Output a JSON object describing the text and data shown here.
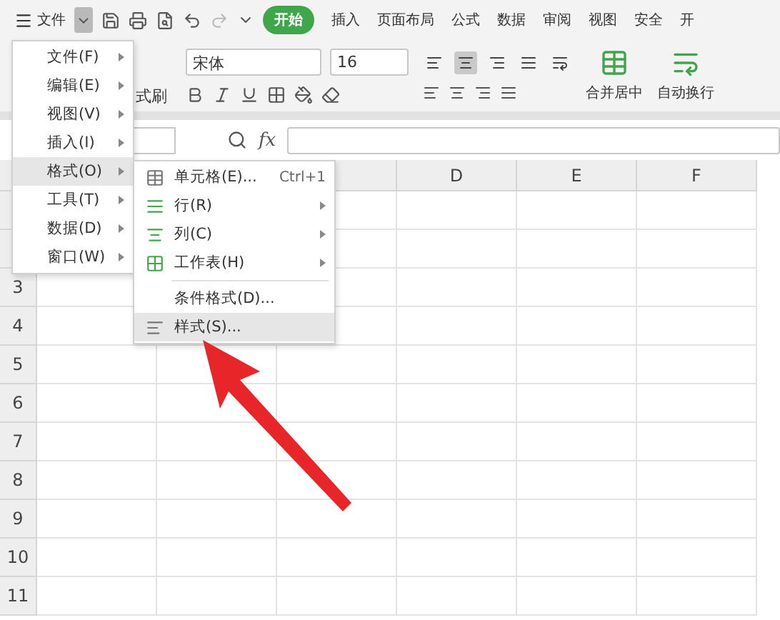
{
  "menu_bar": {
    "file_button": "文件",
    "start_tab": "开始",
    "tabs": [
      "插入",
      "页面布局",
      "公式",
      "数据",
      "审阅",
      "视图",
      "安全",
      "开"
    ]
  },
  "ribbon": {
    "format_painter": "式刷",
    "font_name": "宋体",
    "font_size": "16",
    "merge_button": "合并居中",
    "wrap_button": "自动换行",
    "align_buttons": [
      {
        "selected": false
      },
      {
        "selected": true
      },
      {
        "selected": false
      },
      {
        "selected": false
      },
      {
        "selected": false
      }
    ]
  },
  "formula_bar": {
    "fx": "fx"
  },
  "sheet": {
    "column_headers": [
      "D",
      "E",
      "F"
    ],
    "row_headers": [
      "3",
      "4",
      "5",
      "6",
      "7",
      "8",
      "9",
      "10",
      "11"
    ]
  },
  "main_menu": [
    {
      "label": "文件(F)",
      "selected": false,
      "has_submenu": true
    },
    {
      "label": "编辑(E)",
      "selected": false,
      "has_submenu": true
    },
    {
      "label": "视图(V)",
      "selected": false,
      "has_submenu": true
    },
    {
      "label": "插入(I)",
      "selected": false,
      "has_submenu": true
    },
    {
      "label": "格式(O)",
      "selected": true,
      "has_submenu": true
    },
    {
      "label": "工具(T)",
      "selected": false,
      "has_submenu": true
    },
    {
      "label": "数据(D)",
      "selected": false,
      "has_submenu": true
    },
    {
      "label": "窗口(W)",
      "selected": false,
      "has_submenu": true
    }
  ],
  "submenu": [
    {
      "kind": "item",
      "label": "单元格(E)...",
      "shortcut": "Ctrl+1",
      "has_submenu": false,
      "selected": false
    },
    {
      "kind": "item",
      "label": "行(R)",
      "has_submenu": true,
      "selected": false
    },
    {
      "kind": "item",
      "label": "列(C)",
      "has_submenu": true,
      "selected": false
    },
    {
      "kind": "item",
      "label": "工作表(H)",
      "has_submenu": true,
      "selected": false
    },
    {
      "kind": "divider"
    },
    {
      "kind": "item",
      "label": "条件格式(D)...",
      "has_submenu": false,
      "selected": false
    },
    {
      "kind": "item",
      "label": "样式(S)...",
      "has_submenu": false,
      "selected": true
    }
  ]
}
